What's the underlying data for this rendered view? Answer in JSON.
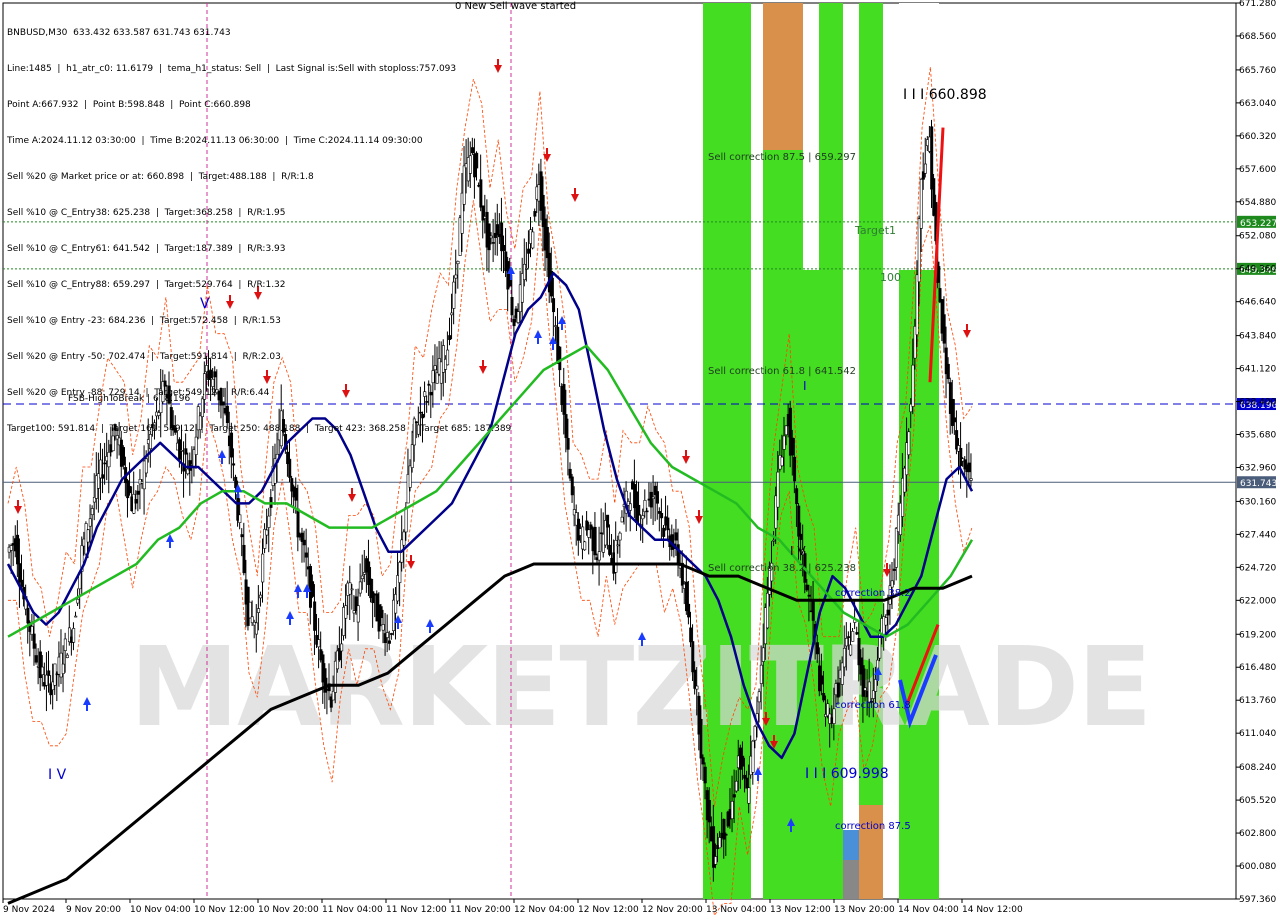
{
  "header": {
    "symbol_line": "BNBUSD,M30  633.432 633.587 631.743 631.743",
    "info_lines": [
      "Line:1485  |  h1_atr_c0: 11.6179  |  tema_h1_status: Sell  |  Last Signal is:Sell with stoploss:757.093",
      "Point A:667.932  |  Point B:598.848  |  Point C:660.898",
      "Time A:2024.11.12 03:30:00  |  Time B:2024.11.13 06:30:00  |  Time C:2024.11.14 09:30:00",
      "Sell %20 @ Market price or at: 660.898  |  Target:488.188  |  R/R:1.8",
      "Sell %10 @ C_Entry38: 625.238  |  Target:368.258  |  R/R:1.95",
      "Sell %10 @ C_Entry61: 641.542  |  Target:187.389  |  R/R:3.93",
      "Sell %10 @ C_Entry88: 659.297  |  Target:529.764  |  R/R:1.32",
      "Sell %10 @ Entry -23: 684.236  |  Target:572.458  |  R/R:1.53",
      "Sell %20 @ Entry -50: 702.474  |  Target:591.814  |  R/R:2.03",
      "Sell %20 @ Entry -88: 729.14  |  Target:549.12  |  R/R:6.44",
      "Target100: 591.814  |  Target 161: 549.12  |  Target 250: 488.188  |  Target 423: 368.258  |  Target 685: 187.389"
    ]
  },
  "watermark": "MARKETZITRADE",
  "chart_data": {
    "type": "candlestick",
    "symbol": "BNBUSD",
    "timeframe": "M30",
    "ylim": [
      597.36,
      671.28
    ],
    "y_ticks": [
      "671.280",
      "668.560",
      "665.760",
      "663.040",
      "660.320",
      "657.600",
      "654.880",
      "652.080",
      "649.360",
      "646.640",
      "643.840",
      "641.120",
      "638.400",
      "635.680",
      "632.960",
      "630.160",
      "627.440",
      "624.720",
      "622.000",
      "619.200",
      "616.480",
      "613.760",
      "611.040",
      "608.240",
      "605.520",
      "602.800",
      "600.080",
      "597.360"
    ],
    "x_ticks": [
      "9 Nov 2024",
      "9 Nov 20:00",
      "10 Nov 04:00",
      "10 Nov 12:00",
      "10 Nov 20:00",
      "11 Nov 04:00",
      "11 Nov 12:00",
      "11 Nov 20:00",
      "12 Nov 04:00",
      "12 Nov 12:00",
      "12 Nov 20:00",
      "13 Nov 04:00",
      "13 Nov 12:00",
      "13 Nov 20:00",
      "14 Nov 04:00",
      "14 Nov 12:00"
    ],
    "current_price": 631.743,
    "price_path": [
      626,
      627,
      622,
      619,
      616,
      615,
      616,
      618,
      620,
      626,
      629,
      632,
      634,
      636,
      633,
      630,
      631,
      635,
      637,
      640,
      636,
      634,
      633,
      637,
      641,
      640,
      638,
      634,
      628,
      621,
      620,
      627,
      632,
      637,
      633,
      628,
      625,
      620,
      616,
      614,
      618,
      623,
      621,
      625,
      622,
      620,
      619,
      623,
      630,
      636,
      638,
      640,
      641,
      643,
      649,
      657,
      659,
      655,
      651,
      653,
      650,
      645,
      648,
      652,
      657,
      650,
      644,
      637,
      630,
      627,
      628,
      626,
      628,
      625,
      629,
      631,
      629,
      630,
      631,
      628,
      627,
      625,
      620,
      614,
      606,
      601,
      603,
      604,
      609,
      606,
      611,
      619,
      626,
      634,
      637,
      629,
      624,
      620,
      614,
      612,
      615,
      618,
      620,
      615,
      614,
      619,
      621,
      627,
      633,
      641,
      657,
      660,
      648,
      641,
      636,
      633,
      632
    ],
    "series": [
      {
        "name": "",
        "color": "#ff0000",
        "values": []
      },
      {
        "name": "",
        "color": "#00008b",
        "values": [
          625,
          623,
          621,
          620,
          621,
          623,
          625,
          628,
          630,
          632,
          633,
          634,
          635,
          634,
          633,
          633,
          632,
          631,
          630,
          630,
          631,
          633,
          635,
          636,
          637,
          637,
          636,
          634,
          631,
          628,
          626,
          626,
          627,
          628,
          629,
          630,
          632,
          634,
          636,
          640,
          644,
          646,
          647,
          649,
          648,
          646,
          641,
          636,
          632,
          629,
          628,
          627,
          627,
          626,
          625,
          624,
          622,
          619,
          615,
          612,
          610,
          609,
          611,
          616,
          621,
          624,
          623,
          621,
          619,
          619,
          620,
          622,
          624,
          628,
          632,
          633,
          631
        ]
      },
      {
        "name": "",
        "color": "#22bb22",
        "values": [
          619,
          620,
          621,
          622,
          623,
          624,
          625,
          627,
          628,
          630,
          631,
          631,
          630,
          630,
          629,
          628,
          628,
          628,
          629,
          630,
          631,
          633,
          635,
          637,
          639,
          641,
          642,
          643,
          641,
          638,
          635,
          633,
          632,
          631,
          630,
          628,
          627,
          625,
          623,
          621,
          620,
          619,
          620,
          622,
          624,
          627
        ]
      },
      {
        "name": "",
        "color": "#000000",
        "values": [
          597,
          598,
          599,
          601,
          603,
          605,
          607,
          609,
          611,
          613,
          614,
          615,
          615,
          616,
          618,
          620,
          622,
          624,
          625,
          625,
          625,
          625,
          625,
          625,
          624,
          624,
          623,
          622,
          622,
          622,
          622,
          623,
          623,
          624
        ]
      }
    ],
    "horizontal_levels": [
      {
        "label": "FSB-HighToBreak | 638.196",
        "value": 638.196,
        "color": "#0000cd",
        "tag": "638.196"
      },
      {
        "label": "",
        "value": 631.743,
        "color": "#4a5d7a",
        "tag": "631.743"
      },
      {
        "label": "",
        "value": 653.227,
        "color": "#1e8a1e",
        "tag": "653.227"
      },
      {
        "label": "",
        "value": 649.346,
        "color": "#1e8a1e",
        "tag": "649.346"
      }
    ],
    "annotations": [
      {
        "text": "0 New Sell wave started",
        "color": "#000000"
      },
      {
        "text": "I I I 660.898",
        "color": "#000000"
      },
      {
        "text": "I I I 609.998",
        "color": "#0000cd"
      },
      {
        "text": "I V",
        "color": "#0000cd"
      },
      {
        "text": "V",
        "color": "#0000cd"
      },
      {
        "text": "I",
        "color": "#0000cd"
      },
      {
        "text": "I V",
        "color": "#000000"
      },
      {
        "text": "Sell correction 87.5 | 659.297",
        "color": "#1f3d1f"
      },
      {
        "text": "Sell correction 61.8 | 641.542",
        "color": "#1f3d1f"
      },
      {
        "text": "Sell correction 38.2 | 625.238",
        "color": "#1f3d1f"
      },
      {
        "text": "Target1",
        "color": "#2e7d32"
      },
      {
        "text": "100",
        "color": "#2e7d32"
      },
      {
        "text": "correction 38.2",
        "color": "#0000cd"
      },
      {
        "text": "correction 61.8",
        "color": "#0000cd"
      },
      {
        "text": "correction 87.5",
        "color": "#0000cd"
      }
    ]
  },
  "colors": {
    "background": "#ffffff",
    "bull_candle": "#000000",
    "bear_candle": "#000000",
    "band_green": "#44dd22",
    "band_orange": "#d9904a",
    "band_blue": "#4a90d9",
    "band_gray": "#888888",
    "arrow_up": "#1a3cff",
    "arrow_down": "#dd1111",
    "watermark": "#d8d8d8",
    "vline": "#cc3399"
  }
}
